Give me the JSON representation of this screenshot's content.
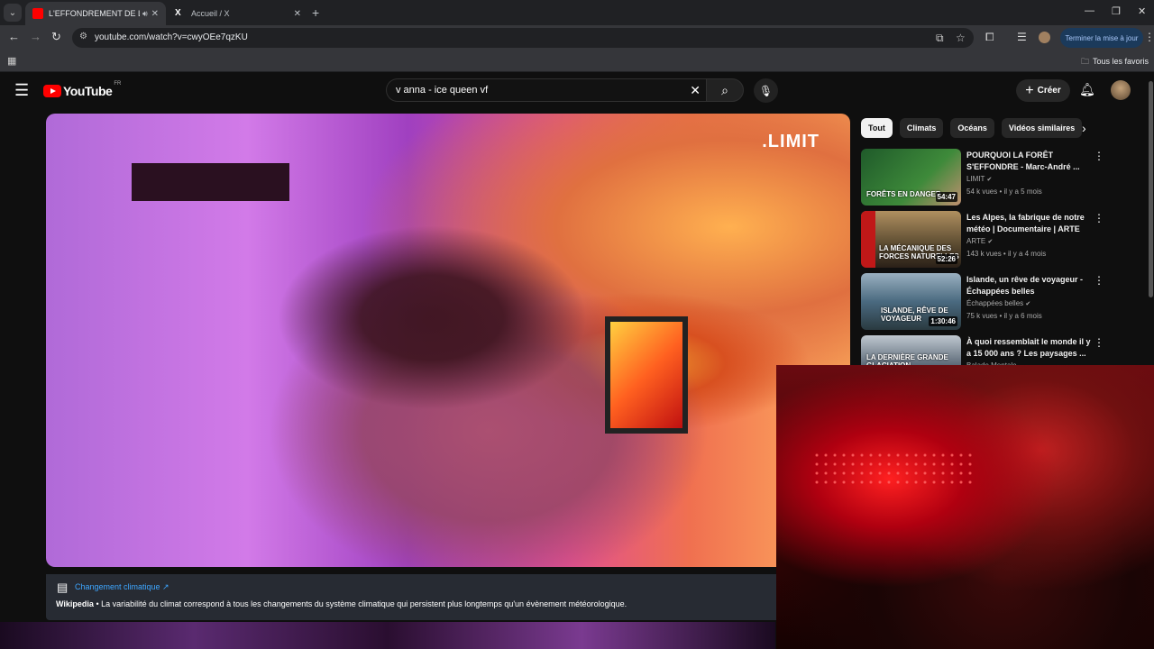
{
  "browser": {
    "tabs": [
      {
        "title": "L'EFFONDREMENT DE L'AM",
        "favicon_color": "#ff0000",
        "active": true
      },
      {
        "title": "Accueil / X",
        "favicon_color": "#000000",
        "active": false
      }
    ],
    "new_tab": "+",
    "url": "youtube.com/watch?v=cwyOEe7qzKU",
    "update_button": "Terminer la mise à jour",
    "bookmarks_all": "Tous les favoris"
  },
  "header": {
    "logo_text": "YouTube",
    "country": "FR",
    "search_value": "v anna - ice queen vf",
    "create_label": "Créer"
  },
  "video": {
    "watermark": ".LIMIT"
  },
  "wiki_card": {
    "link": "Changement climatique ↗",
    "source": "Wikipedia",
    "separator": " • ",
    "text": "La variabilité du climat correspond à tous les changements du système climatique qui persistent plus longtemps qu'un évènement météorologique."
  },
  "chips": [
    "Tout",
    "Climats",
    "Océans",
    "Vidéos similaires"
  ],
  "recommendations": [
    {
      "title": "POURQUOI LA FORÊT S'EFFONDRE - Marc-André ...",
      "channel": "LIMIT",
      "views": "54 k vues",
      "age": "il y a 5 mois",
      "duration": "54:47",
      "overlay": "FORÊTS EN DANGER",
      "colors": [
        "#1f5a2a",
        "#3e8a3a"
      ]
    },
    {
      "title": "Les Alpes, la fabrique de notre météo | Documentaire | ARTE",
      "channel": "ARTE",
      "views": "143 k vues",
      "age": "il y a 4 mois",
      "duration": "52:26",
      "overlay": "LA MÉCANIQUE DES FORCES NATURELLES",
      "colors": [
        "#5a4a30",
        "#b09060"
      ]
    },
    {
      "title": "Islande, un rêve de voyageur - Échappées belles",
      "channel": "Échappées belles",
      "views": "75 k vues",
      "age": "il y a 6 mois",
      "duration": "1:30:46",
      "overlay": "ISLANDE, RÊVE DE VOYAGEUR",
      "colors": [
        "#4a6a80",
        "#9ab0c0"
      ]
    },
    {
      "title": "À quoi ressemblait le monde il y a 15 000 ans ? Les paysages ...",
      "channel": "Balade Mentale",
      "views": "",
      "age": "",
      "duration": "",
      "overlay": "LA DERNIÈRE GRANDE GLACIATION",
      "colors": [
        "#3a4a5a",
        "#c0c8d0"
      ]
    }
  ]
}
